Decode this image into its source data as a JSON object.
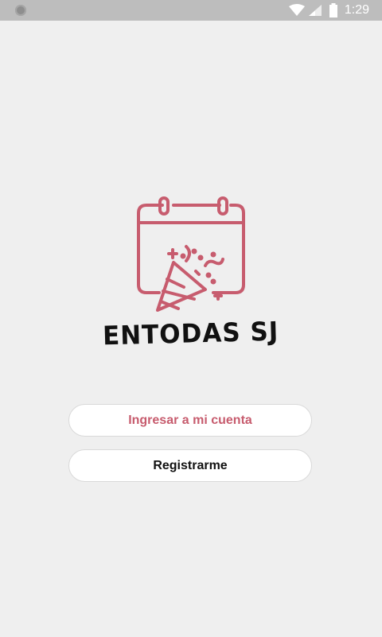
{
  "status_bar": {
    "time": "1:29",
    "icons": [
      "notification-dot-icon",
      "wifi-icon",
      "signal-icon",
      "battery-icon"
    ]
  },
  "logo": {
    "icon": "calendar-party-popper-icon",
    "app_name": "ENTODAS SJ"
  },
  "buttons": {
    "login_label": "Ingresar a mi cuenta",
    "register_label": "Registrarme"
  },
  "colors": {
    "accent": "#c75c6e",
    "background": "#efefef",
    "status_bar": "#bdbdbd"
  }
}
